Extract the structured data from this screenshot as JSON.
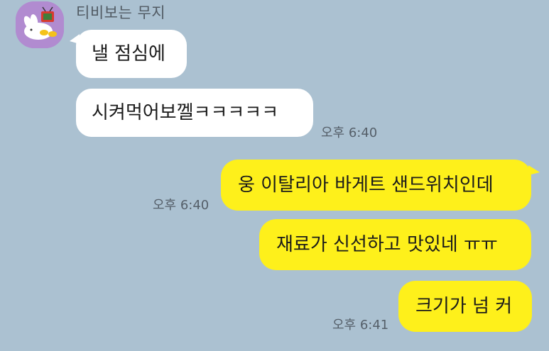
{
  "sender": {
    "name": "티비보는 무지"
  },
  "messages": [
    {
      "direction": "in",
      "text": "낼 점심에",
      "time": ""
    },
    {
      "direction": "in",
      "text": "시켜먹어보껠ㅋㅋㅋㅋㅋ",
      "time": "오후 6:40"
    },
    {
      "direction": "out",
      "text": "웅 이탈리아 바게트 샌드위치인데",
      "time": "오후 6:40"
    },
    {
      "direction": "out",
      "text": "재료가 신선하고 맛있네 ㅠㅠ",
      "time": ""
    },
    {
      "direction": "out",
      "text": "크기가 넘 커",
      "time": "오후 6:41"
    }
  ],
  "colors": {
    "background": "#abc1d1",
    "incoming_bubble": "#ffffff",
    "outgoing_bubble": "#fef01b",
    "avatar_bg": "#b18bd0"
  },
  "icons": {
    "avatar": "muzi-watching-tv-avatar"
  }
}
